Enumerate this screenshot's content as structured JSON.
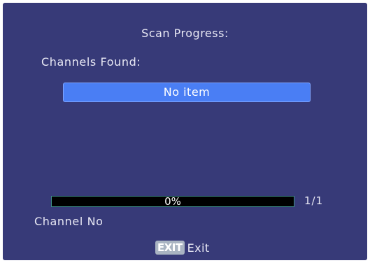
{
  "screen": {
    "title": "Scan Progress:",
    "channels_found_label": "Channels Found:",
    "channel_list": {
      "items": [],
      "empty_text": "No item"
    },
    "progress": {
      "percent_text": "0%",
      "fraction": 0,
      "page_counter": "1/1"
    },
    "channel_no_label": "Channel No",
    "footer": {
      "exit_key_label": "EXIT",
      "exit_text": "Exit"
    }
  },
  "colors": {
    "background": "#373a78",
    "highlight": "#4a7ef4",
    "progress_track": "#000000",
    "progress_border": "#3f8f8a",
    "key_badge": "#a9b4c2"
  }
}
